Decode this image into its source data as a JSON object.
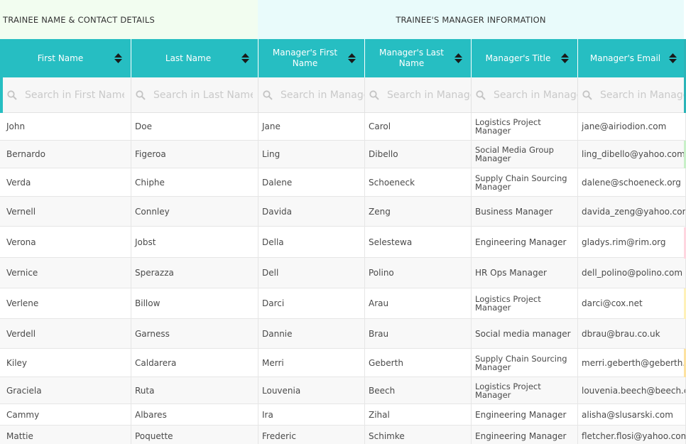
{
  "groups": {
    "trainee": "TRAINEE NAME & CONTACT DETAILS",
    "manager": "TRAINEE'S MANAGER INFORMATION"
  },
  "columns": [
    {
      "label": "First Name",
      "placeholder": "Search in First Name"
    },
    {
      "label": "Last Name",
      "placeholder": "Search in Last Name"
    },
    {
      "label": "Manager's First Name",
      "placeholder": "Search in Manager's First Name"
    },
    {
      "label": "Manager's Last Name",
      "placeholder": "Search in Manager's Last Name"
    },
    {
      "label": "Manager's Title",
      "placeholder": "Search in Manager's Title"
    },
    {
      "label": "Manager's Email",
      "placeholder": "Search in Manager's Email"
    }
  ],
  "rows": [
    {
      "first": "John",
      "last": "Doe",
      "mfirst": "Jane",
      "mlast": "Carol",
      "title": "Logistics Project Manager",
      "email": "jane@airiodion.com"
    },
    {
      "first": "Bernardo",
      "last": "Figeroa",
      "mfirst": "Ling",
      "mlast": "Dibello",
      "title": "Social Media Group Manager",
      "email": "ling_dibello@yahoo.com"
    },
    {
      "first": "Verda",
      "last": "Chiphe",
      "mfirst": "Dalene",
      "mlast": "Schoeneck",
      "title": "Supply Chain Sourcing Manager",
      "email": "dalene@schoeneck.org"
    },
    {
      "first": "Vernell",
      "last": "Connley",
      "mfirst": "Davida",
      "mlast": "Zeng",
      "title": "Business Manager",
      "email": "davida_zeng@yahoo.com"
    },
    {
      "first": "Verona",
      "last": "Jobst",
      "mfirst": "Della",
      "mlast": "Selestewa",
      "title": "Engineering Manager",
      "email": "gladys.rim@rim.org"
    },
    {
      "first": "Vernice",
      "last": "Sperazza",
      "mfirst": "Dell",
      "mlast": "Polino",
      "title": "HR Ops Manager",
      "email": "dell_polino@polino.com"
    },
    {
      "first": "Verlene",
      "last": "Billow",
      "mfirst": "Darci",
      "mlast": "Arau",
      "title": "Logistics Project Manager",
      "email": "darci@cox.net"
    },
    {
      "first": "Verdell",
      "last": "Garness",
      "mfirst": "Dannie",
      "mlast": "Brau",
      "title": "Social media manager",
      "email": "dbrau@brau.co.uk"
    },
    {
      "first": "Kiley",
      "last": "Caldarera",
      "mfirst": "Merri",
      "mlast": "Geberth",
      "title": "Supply Chain Sourcing Manager",
      "email": "merri.geberth@geberth.com"
    },
    {
      "first": "Graciela",
      "last": "Ruta",
      "mfirst": "Louvenia",
      "mlast": "Beech",
      "title": "Logistics Project Manager",
      "email": "louvenia.beech@beech.com"
    },
    {
      "first": "Cammy",
      "last": "Albares",
      "mfirst": "Ira",
      "mlast": "Zihal",
      "title": "Engineering Manager",
      "email": "alisha@slusarski.com"
    },
    {
      "first": "Mattie",
      "last": "Poquette",
      "mfirst": "Frederic",
      "mlast": "Schimke",
      "title": "Engineering Manager",
      "email": "fletcher.flosi@yahoo.com"
    }
  ],
  "colors": {
    "header_bg": "#26bec2",
    "trainee_group_bg": "#f2fdf0",
    "manager_group_bg": "#e9fbfb",
    "side_strips": [
      "#c8f0c8",
      "#ffffff",
      "#ffffff",
      "#ffd6e0",
      "#ffffff",
      "#fff1b8",
      "#ffffff",
      "#ffffff",
      "#fde2a0",
      "#ffffff",
      "#ffffff"
    ]
  }
}
